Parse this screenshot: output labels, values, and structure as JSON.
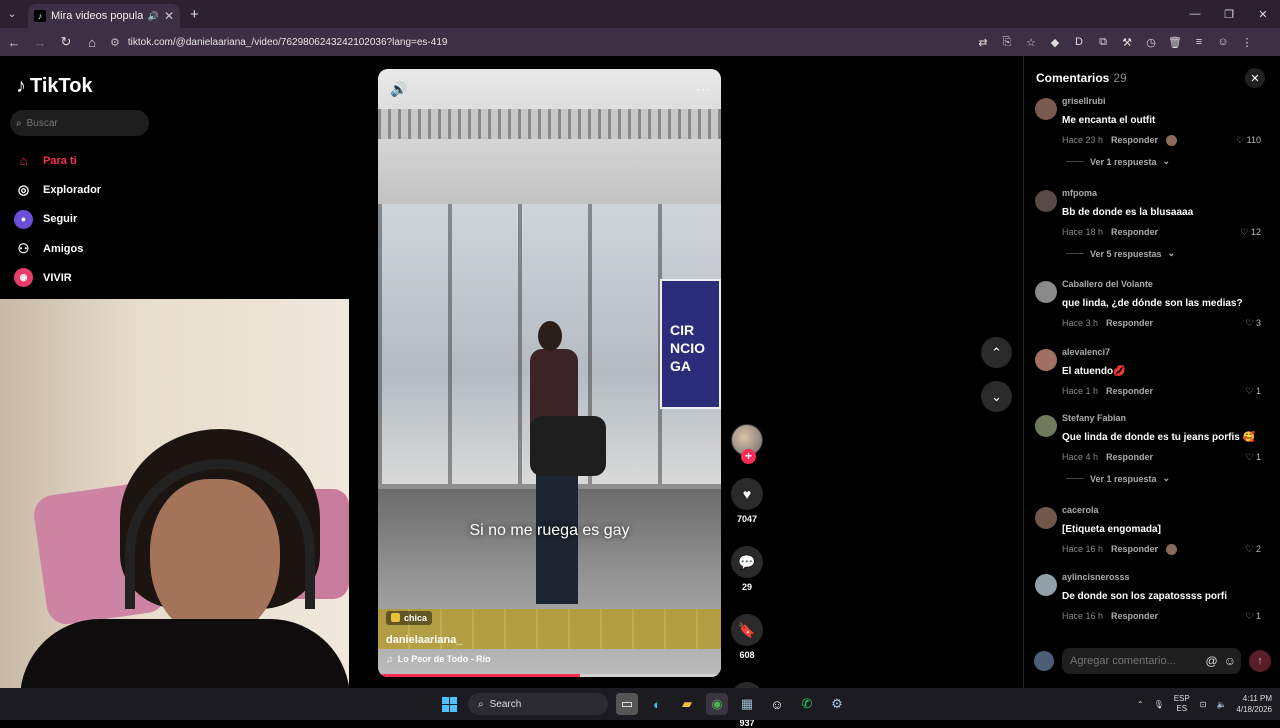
{
  "browser": {
    "tab_title": "Mira videos populares selec",
    "url": "tiktok.com/@danielaariana_/video/7629806243242102036?lang=es-419"
  },
  "sidebar": {
    "logo": "TikTok",
    "search_placeholder": "Buscar",
    "items": [
      {
        "label": "Para ti",
        "icon": "home-icon"
      },
      {
        "label": "Explorador",
        "icon": "compass-icon"
      },
      {
        "label": "Seguir",
        "icon": "following-icon"
      },
      {
        "label": "Amigos",
        "icon": "friends-icon"
      },
      {
        "label": "VIVIR",
        "icon": "live-icon"
      }
    ]
  },
  "video": {
    "caption": "Si no me ruega es gay",
    "tag": "chica",
    "username": "danielaariana_",
    "sound": "Lo Peor de Todo - Río",
    "sign_text": "CIR\nNCIO\nGA",
    "progress": 0.59
  },
  "actions": {
    "likes": "7047",
    "comments": "29",
    "saves": "608",
    "shares": "937"
  },
  "comments": {
    "title": "Comentarios",
    "count": "29",
    "input_placeholder": "Agregar comentario...",
    "reply_label": "Responder",
    "items": [
      {
        "user": "grisellrubi",
        "text": "Me encanta el outfit",
        "time": "Hace 23 h",
        "likes": "110",
        "creator": true,
        "more": "Ver 1 respuesta"
      },
      {
        "user": "mfpoma",
        "text": "Bb de donde es la blusaaaa",
        "time": "Hace 18 h",
        "likes": "12",
        "creator": false,
        "more": "Ver 5 respuestas"
      },
      {
        "user": "Caballero del Volante",
        "text": "que linda, ¿de dónde son las medias?",
        "time": "Hace 3 h",
        "likes": "3",
        "creator": false,
        "more": ""
      },
      {
        "user": "alevalenci7",
        "text": "El atuendo💋",
        "time": "Hace 1 h",
        "likes": "1",
        "creator": false,
        "more": ""
      },
      {
        "user": "Stefany Fabian",
        "text": "Que linda de donde es tu jeans porfis 🥰",
        "time": "Hace 4 h",
        "likes": "1",
        "creator": false,
        "more": "Ver 1 respuesta"
      },
      {
        "user": "cacerola",
        "text": "[Etiqueta engomada]",
        "time": "Hace 16 h",
        "likes": "2",
        "creator": true,
        "more": ""
      },
      {
        "user": "aylincisnerosss",
        "text": "De donde son los zapatossss porfi",
        "time": "Hace 16 h",
        "likes": "1",
        "creator": false,
        "more": ""
      }
    ]
  },
  "taskbar": {
    "search_label": "Search",
    "lang_top": "ESP",
    "lang_bottom": "ES",
    "time": "4:11 PM",
    "date": "4/18/2026"
  },
  "colors": {
    "accent": "#fe2c55",
    "panel": "#000000",
    "chrome": "#3d2f44"
  }
}
